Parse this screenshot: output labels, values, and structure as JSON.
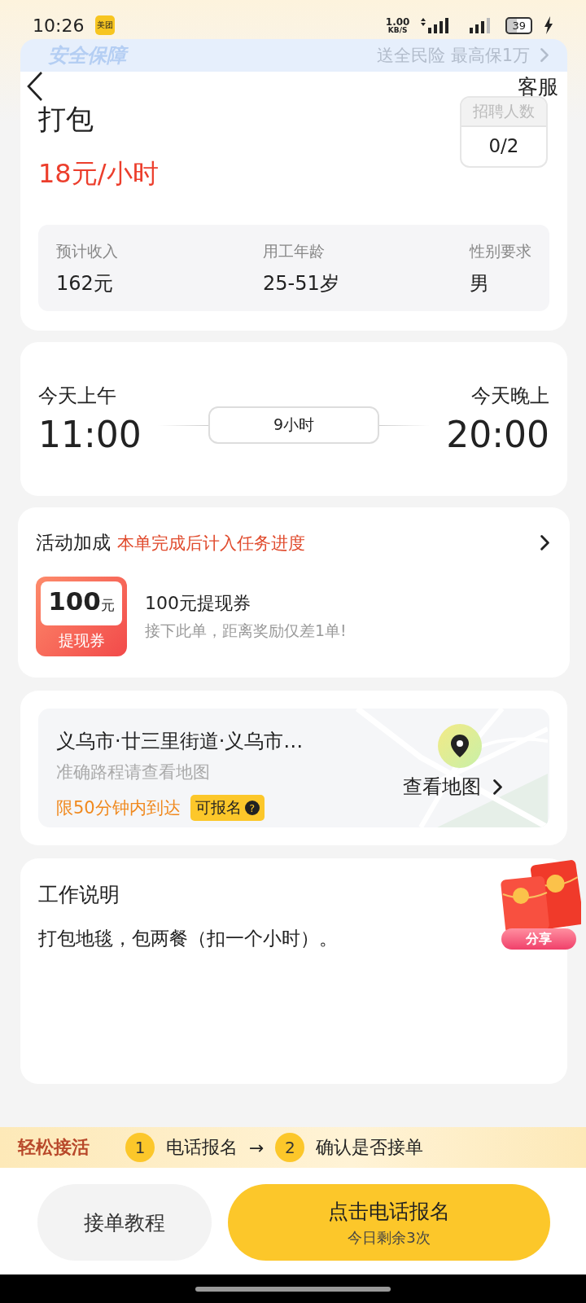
{
  "status_bar": {
    "time": "10:26",
    "app_badge": "美团",
    "net_speed": "1.00",
    "net_unit": "KB/S",
    "battery": "39"
  },
  "banner": {
    "title": "安全保障",
    "promo": "送全民险 最高保1万"
  },
  "nav": {
    "service": "客服"
  },
  "job": {
    "title": "打包",
    "wage": "18元/小时",
    "recruit_label": "招聘人数",
    "recruit_count": "0/2",
    "stats": [
      {
        "label": "预计收入",
        "value": "162元"
      },
      {
        "label": "用工年龄",
        "value": "25-51岁"
      },
      {
        "label": "性别要求",
        "value": "男"
      }
    ]
  },
  "schedule": {
    "start_day": "今天上午",
    "start_time": "11:00",
    "duration": "9小时",
    "end_day": "今天晚上",
    "end_time": "20:00"
  },
  "bonus": {
    "title": "活动加成",
    "note": "本单完成后计入任务进度",
    "coupon": {
      "amount": "100",
      "unit": "元",
      "label": "提现券"
    },
    "name": "100元提现券",
    "hint": "接下此单，距离奖励仅差1单!"
  },
  "location": {
    "address": "义乌市·廿三里街道·义乌市…",
    "hint": "准确路程请查看地图",
    "limit": "限50分钟内到达",
    "tag": "可报名",
    "tag_icon": "?",
    "map_link": "查看地图"
  },
  "share": {
    "label": "分享"
  },
  "description": {
    "title": "工作说明",
    "text": "打包地毯，包两餐（扣一个小时）。"
  },
  "steps_strip": {
    "title": "轻松接活",
    "arrow": "→",
    "steps": [
      {
        "number": "1",
        "label": "电话报名"
      },
      {
        "number": "2",
        "label": "确认是否接单"
      }
    ]
  },
  "actions": {
    "tutorial": "接单教程",
    "primary": "点击电话报名",
    "primary_sub": "今日剩余3次"
  }
}
